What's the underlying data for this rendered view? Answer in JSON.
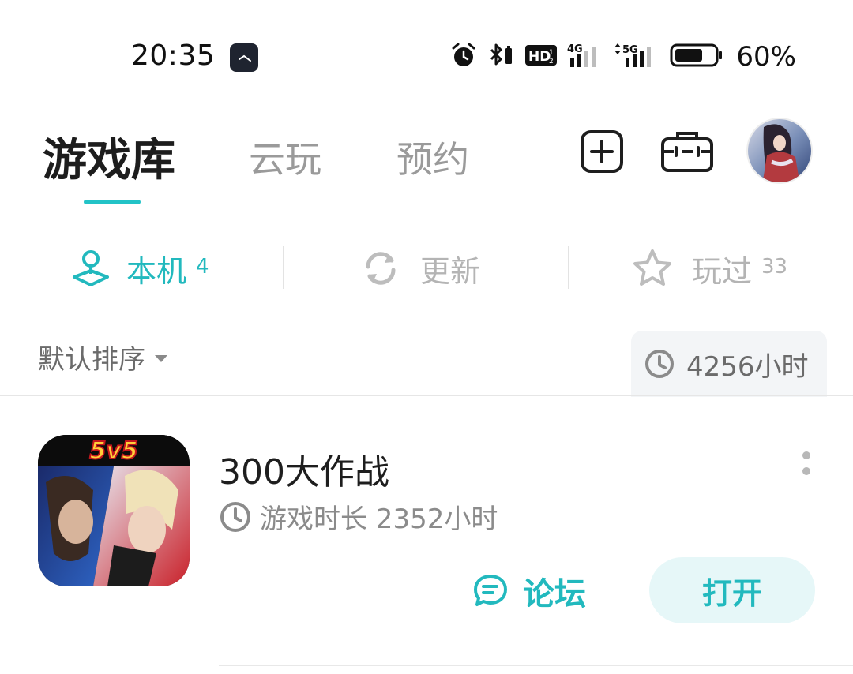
{
  "status_bar": {
    "time": "20:35",
    "battery_percent": "60%",
    "network_4g": "4G",
    "network_5g": "5G",
    "hd_badge": "HD",
    "icons": [
      "clock-app-icon",
      "alarm-icon",
      "bluetooth-icon",
      "hd-voice-icon",
      "signal-4g-icon",
      "signal-5g-icon",
      "battery-icon"
    ]
  },
  "header": {
    "tabs": [
      {
        "label": "游戏库",
        "active": true
      },
      {
        "label": "云玩",
        "active": false
      },
      {
        "label": "预约",
        "active": false
      }
    ],
    "actions": [
      "add-game-icon",
      "toolbox-icon",
      "avatar"
    ]
  },
  "filters": [
    {
      "label": "本机",
      "count": "4",
      "icon": "local-device-icon",
      "active": true
    },
    {
      "label": "更新",
      "count": "",
      "icon": "refresh-icon",
      "active": false
    },
    {
      "label": "玩过",
      "count": "33",
      "icon": "star-icon",
      "active": false
    }
  ],
  "sort": {
    "label": "默认排序",
    "total_time": "4256小时"
  },
  "games": [
    {
      "title": "300大作战",
      "playtime": "游戏时长 2352小时",
      "forum_label": "论坛",
      "open_label": "打开",
      "icon_badge": "5v5"
    }
  ],
  "colors": {
    "accent": "#22b9be",
    "accent_bg": "#e6f7f8",
    "text_primary": "#1e1e1e",
    "text_secondary": "#8b8b8b"
  }
}
